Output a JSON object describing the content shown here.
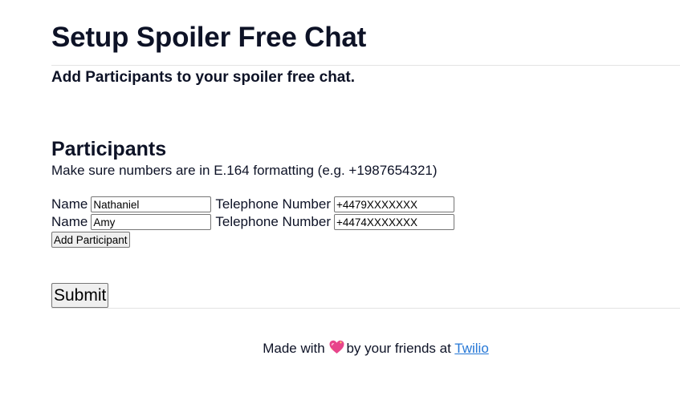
{
  "header": {
    "title": "Setup Spoiler Free Chat",
    "subtitle": "Add Participants to your spoiler free chat."
  },
  "participants": {
    "heading": "Participants",
    "hint": "Make sure numbers are in E.164 formatting (e.g. +1987654321)",
    "name_label": "Name",
    "phone_label": "Telephone Number",
    "rows": [
      {
        "name": "Nathaniel",
        "phone": "+4479XXXXXXX"
      },
      {
        "name": "Amy",
        "phone": "+4474XXXXXXX"
      }
    ],
    "add_button": "Add Participant"
  },
  "form": {
    "submit_label": "Submit"
  },
  "footer": {
    "prefix": "Made with",
    "icon": "sparkling-heart-icon",
    "middle": "by your friends at",
    "link_text": "Twilio"
  },
  "colors": {
    "text": "#0d1226",
    "link": "#2577d6",
    "heart": "#e8458b"
  }
}
